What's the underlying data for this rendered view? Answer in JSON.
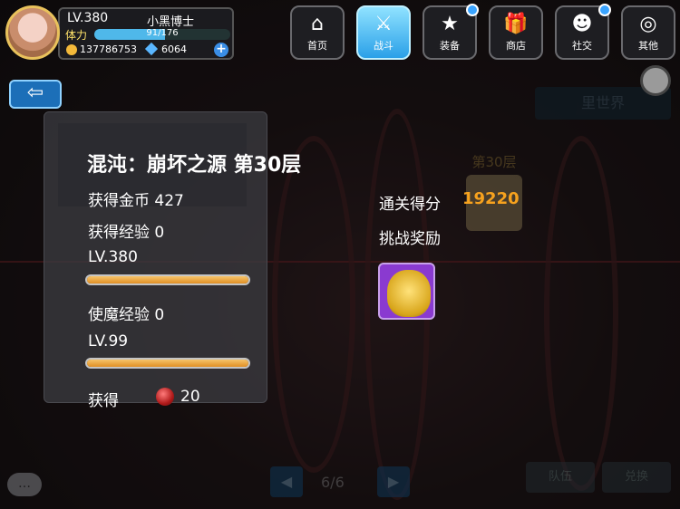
{
  "player": {
    "level": "LV.380",
    "name": "小黑博士",
    "stamina_label": "体力",
    "stamina_text": "91/176",
    "stamina_fraction": 0.517,
    "coins": "137786753",
    "gems": "6064",
    "add_label": "+"
  },
  "nav": [
    {
      "label": "首页",
      "icon": "home-icon",
      "glyph": "⌂"
    },
    {
      "label": "战斗",
      "icon": "swords-icon",
      "glyph": "⚔"
    },
    {
      "label": "装备",
      "icon": "gun-star-icon",
      "glyph": "★"
    },
    {
      "label": "商店",
      "icon": "gift-icon",
      "glyph": "🎁"
    },
    {
      "label": "社交",
      "icon": "skull-icon",
      "glyph": "☻"
    },
    {
      "label": "其他",
      "icon": "target-icon",
      "glyph": "◎"
    }
  ],
  "world_button": "里世界",
  "back_glyph": "⇦",
  "result": {
    "title": "混沌：崩坏之源 第30层",
    "gold": "获得金币 427",
    "exp": "获得经验 0",
    "level": "LV.380",
    "level_bar_fraction": 1.0,
    "familiar_exp": "使魔经验 0",
    "familiar_level": "LV.99",
    "familiar_bar_fraction": 1.0,
    "obtain_label": "获得",
    "obtain_count": "20"
  },
  "score": {
    "label": "通关得分",
    "value": "19220"
  },
  "reward_label": "挑战奖励",
  "floor_badge": "第30层",
  "pager": {
    "text": "6/6",
    "prev": "◀",
    "next": "▶"
  },
  "chat_glyph": "…",
  "bottom_buttons": [
    "队伍",
    "兑换"
  ]
}
